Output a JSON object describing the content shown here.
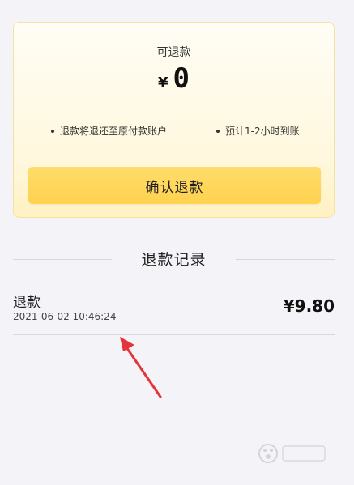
{
  "refund_card": {
    "label": "可退款",
    "currency": "¥",
    "amount": "0",
    "notes": [
      "退款将退还至原付款账户",
      "预计1-2小时到账"
    ],
    "confirm_label": "确认退款"
  },
  "records": {
    "title": "退款记录",
    "items": [
      {
        "title": "退款",
        "time": "2021-06-02 10:46:24",
        "amount": "¥9.80"
      }
    ]
  },
  "colors": {
    "button": "#ffd24f",
    "card_bg": "#fff8de",
    "arrow": "#e5333a",
    "background": "#f4f3f8"
  }
}
